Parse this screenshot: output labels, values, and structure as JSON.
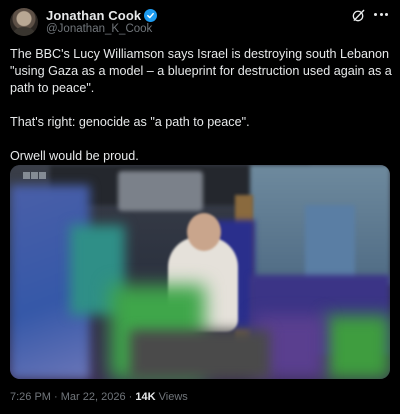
{
  "author": {
    "display_name": "Jonathan Cook",
    "handle": "@Jonathan_K_Cook",
    "verified": true
  },
  "icons": {
    "verified": "verified-badge-icon",
    "grok": "grok-icon",
    "more": "more-options-icon"
  },
  "tweet": {
    "paragraphs": [
      "The BBC's Lucy Williamson says Israel is destroying south Lebanon \"using Gaza as a model – a blueprint for destruction used again as a path to peace\".",
      "That's right: genocide as \"a path to peace\".",
      "Orwell would be proud."
    ]
  },
  "media": {
    "type": "video",
    "watermark": "BBC",
    "description_visible": false
  },
  "meta": {
    "time": "7:26 PM",
    "separator": "·",
    "date": "Mar 22, 2026",
    "views_count": "14K",
    "views_label": "Views"
  },
  "colors": {
    "background": "#000000",
    "text_primary": "#e7e9ea",
    "text_secondary": "#71767b",
    "verified_blue": "#1d9bf0"
  }
}
